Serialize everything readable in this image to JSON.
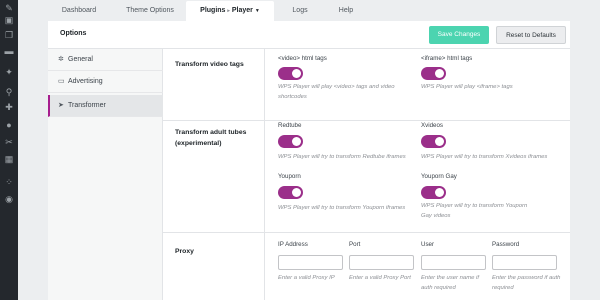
{
  "tabs": [
    "Dashboard",
    "Theme Options",
    "Plugins",
    "Player",
    "Logs",
    "Help"
  ],
  "panel": {
    "title": "Options",
    "save_label": "Save Changes",
    "reset_label": "Reset to Defaults"
  },
  "nav": [
    {
      "label": "General",
      "icon": "gear-icon"
    },
    {
      "label": "Advertising",
      "icon": "advertising-icon"
    },
    {
      "label": "Transformer",
      "icon": "rocket-icon"
    }
  ],
  "sections": {
    "video_tags": {
      "label": "Transform video tags",
      "video_label": "<video> html tags",
      "video_desc": "WPS Player will play <video> tags and video shortcodes",
      "iframe_label": "<iframe> html tags",
      "iframe_desc": "WPS Player will play <iframe> tags"
    },
    "adult_tubes": {
      "label": "Transform adult tubes (experimental)",
      "redtube_label": "Redtube",
      "redtube_desc": "WPS Player will try to transform Redtube iframes",
      "xvideos_label": "Xvideos",
      "xvideos_desc": "WPS Player will try to transform Xvideos iframes",
      "youporn_label": "Youporn",
      "youporn_desc": "WPS Player will try to transform Youporn iframes",
      "youporngay_label": "Youporn Gay",
      "youporngay_desc": "WPS Player will try to transform Youporn Gay videos"
    },
    "proxy": {
      "label": "Proxy",
      "ip_label": "IP Address",
      "ip_desc": "Enter a valid Proxy IP",
      "port_label": "Port",
      "port_desc": "Enter a valid Proxy Port",
      "user_label": "User",
      "user_desc": "Enter the user name if auth required",
      "password_label": "Password",
      "password_desc": "Enter the password if auth required"
    }
  },
  "colors": {
    "toggle_on": "#9b2f8a",
    "save_button": "#4cd4b0",
    "active_nav_border": "#a71d8e"
  }
}
